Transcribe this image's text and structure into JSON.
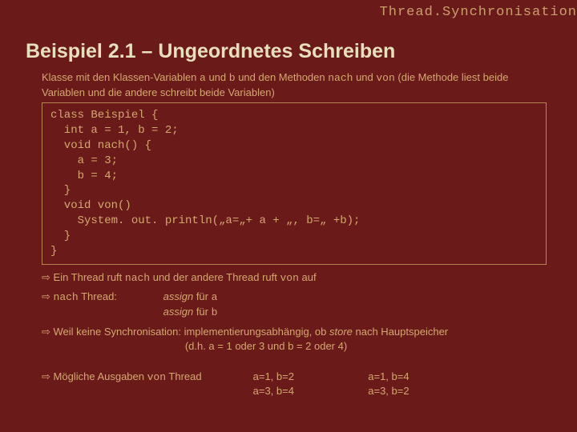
{
  "header": "Thread.Synchronisation",
  "title": "Beispiel 2.1 – Ungeordnetes Schreiben",
  "intro": {
    "t1": "Klasse mit den Klassen-Variablen ",
    "a": "a",
    "t2": " und ",
    "b": "b",
    "t3": " und den Methoden ",
    "nach": "nach",
    "t4": " und ",
    "von": "von",
    "t5": " (die Methode liest beide Variablen und die andere schreibt beide Variablen)"
  },
  "code": "class Beispiel {\n  int a = 1, b = 2;\n  void nach() {\n    a = 3;\n    b = 4;\n  }\n  void von()\n    System. out. println(„a=„+ a + „, b=„ +b);\n  }\n}",
  "bullet1": {
    "arrow": "⇨",
    "t1": " Ein Thread ruft ",
    "nach": "nach",
    "t2": " und der andere Thread ruft ",
    "von": "von",
    "t3": " auf"
  },
  "bullet2": {
    "arrow": "⇨ ",
    "nach": "nach",
    "t1": " Thread:",
    "assign1a": "assign",
    "assign1b": " für ",
    "assign1c": "a",
    "assign2a": "assign",
    "assign2b": " für ",
    "assign2c": "b"
  },
  "bullet3": {
    "arrow": "⇨",
    "t1": " Weil keine Synchronisation: implementierungsabhängig, ob ",
    "store": "store",
    "t2": " nach Hauptspeicher",
    "t3": "(d.h. a = 1 oder 3 und b = 2 oder 4)"
  },
  "bullet4": {
    "arrow": "⇨",
    "t1": " Mögliche Ausgaben ",
    "von": "von",
    "t2": " Thread",
    "c1a": "a=1,  b=2",
    "c1b": "a=3,  b=4",
    "c2a": "a=1,  b=4",
    "c2b": "a=3,  b=2"
  }
}
